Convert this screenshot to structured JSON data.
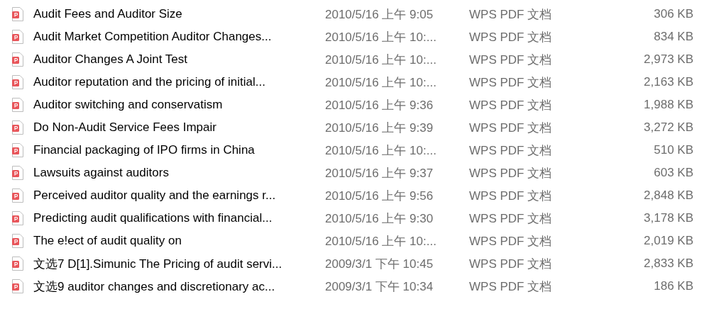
{
  "files": [
    {
      "name": "Audit Fees and Auditor Size",
      "modified": "2010/5/16 上午 9:05",
      "type": "WPS PDF 文档",
      "size": "306 KB"
    },
    {
      "name": "Audit Market Competition Auditor Changes...",
      "modified": "2010/5/16 上午 10:...",
      "type": "WPS PDF 文档",
      "size": "834 KB"
    },
    {
      "name": "Auditor Changes A Joint Test",
      "modified": "2010/5/16 上午 10:...",
      "type": "WPS PDF 文档",
      "size": "2,973 KB"
    },
    {
      "name": "Auditor reputation and the pricing of initial...",
      "modified": "2010/5/16 上午 10:...",
      "type": "WPS PDF 文档",
      "size": "2,163 KB"
    },
    {
      "name": "Auditor switching and conservatism",
      "modified": "2010/5/16 上午 9:36",
      "type": "WPS PDF 文档",
      "size": "1,988 KB"
    },
    {
      "name": "Do Non-Audit Service Fees Impair",
      "modified": "2010/5/16 上午 9:39",
      "type": "WPS PDF 文档",
      "size": "3,272 KB"
    },
    {
      "name": "Financial packaging of IPO firms in China",
      "modified": "2010/5/16 上午 10:...",
      "type": "WPS PDF 文档",
      "size": "510 KB"
    },
    {
      "name": "Lawsuits against auditors",
      "modified": "2010/5/16 上午 9:37",
      "type": "WPS PDF 文档",
      "size": "603 KB"
    },
    {
      "name": "Perceived auditor quality and the earnings r...",
      "modified": "2010/5/16 上午 9:56",
      "type": "WPS PDF 文档",
      "size": "2,848 KB"
    },
    {
      "name": "Predicting audit qualifications with financial...",
      "modified": "2010/5/16 上午 9:30",
      "type": "WPS PDF 文档",
      "size": "3,178 KB"
    },
    {
      "name": "The e!ect of audit quality on",
      "modified": "2010/5/16 上午 10:...",
      "type": "WPS PDF 文档",
      "size": "2,019 KB"
    },
    {
      "name": "文选7 D[1].Simunic The Pricing of audit servi...",
      "modified": "2009/3/1 下午 10:45",
      "type": "WPS PDF 文档",
      "size": "2,833 KB"
    },
    {
      "name": "文选9 auditor changes and discretionary ac...",
      "modified": "2009/3/1 下午 10:34",
      "type": "WPS PDF 文档",
      "size": "186 KB"
    }
  ]
}
